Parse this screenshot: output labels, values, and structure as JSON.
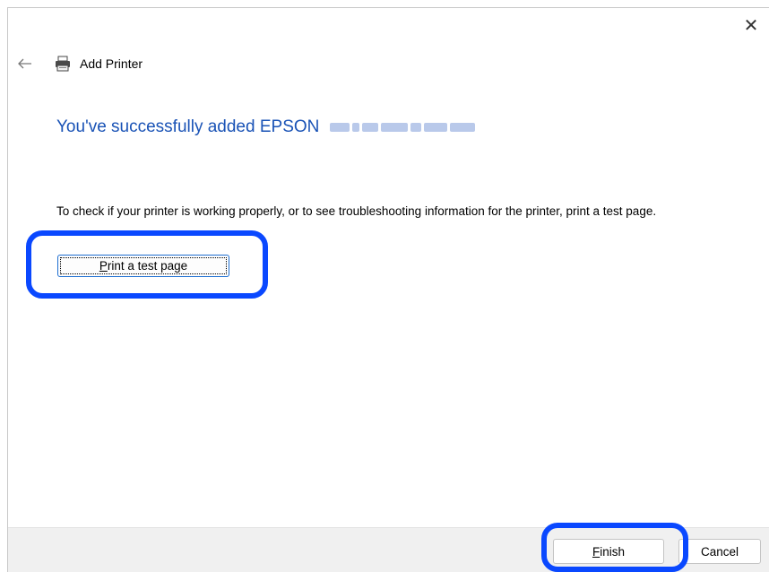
{
  "window": {
    "title": "Add Printer",
    "close_glyph": "✕",
    "back_icon": "back-arrow-icon",
    "printer_icon": "printer-icon"
  },
  "content": {
    "heading_prefix": "You've successfully added EPSON",
    "description": "To check if your printer is working properly, or to see troubleshooting information for the printer, print a test page.",
    "test_button": {
      "accel": "P",
      "rest": "rint a test page"
    }
  },
  "footer": {
    "finish": {
      "accel": "F",
      "rest": "inish"
    },
    "cancel_label": "Cancel"
  },
  "colors": {
    "heading": "#1a53b6",
    "highlight": "#0a48ff",
    "footer_bg": "#f0f0f0"
  }
}
